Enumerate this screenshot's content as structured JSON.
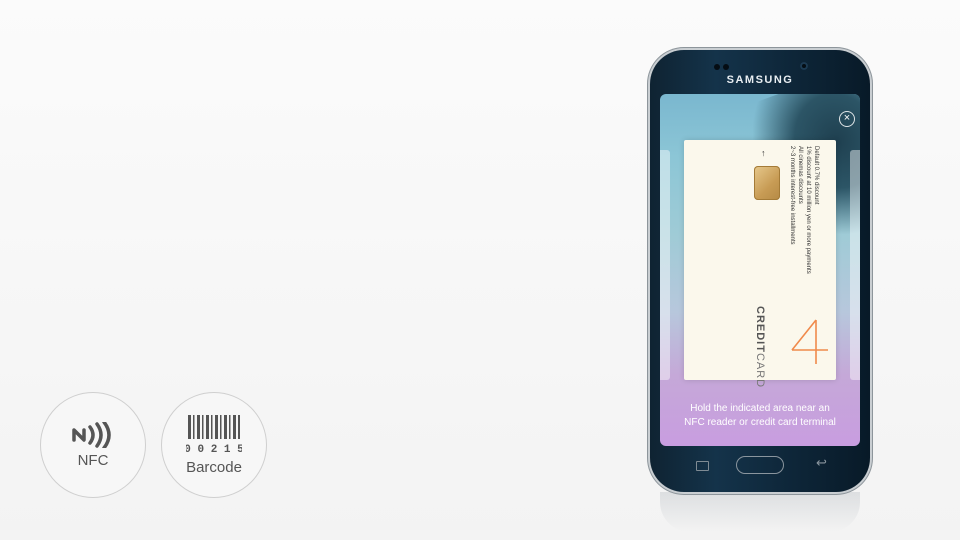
{
  "modes": [
    {
      "label": "NFC",
      "icon": "nfc-icon"
    },
    {
      "label": "Barcode",
      "icon": "barcode-icon",
      "digits": "0 0 2 1 5"
    }
  ],
  "phone": {
    "brand": "SAMSUNG",
    "instruction_line1": "Hold the indicated area near an",
    "instruction_line2": "NFC reader or credit card terminal",
    "card": {
      "title_bold": "CREDIT",
      "title_light": "CARD",
      "benefits": [
        "Default 0.7% discount",
        "1% discount at 10 million yen or more payments",
        "All cinemas discounts",
        "2~3 months interest-free installments"
      ]
    }
  },
  "colors": {
    "phone_body": "#0f2332",
    "card_bg": "#fbf8ec",
    "card_logo": "#f08a4b",
    "screen_top": "#7ab7cf",
    "screen_bottom": "#c89de0"
  }
}
